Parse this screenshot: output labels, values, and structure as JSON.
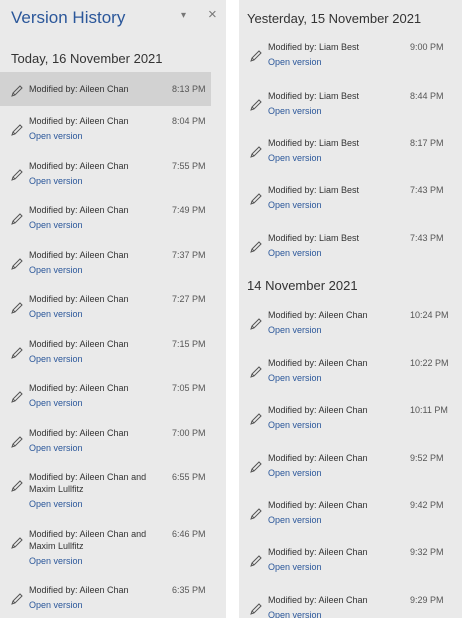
{
  "left_panel": {
    "title": "Version History",
    "chevron_glyph": "▾",
    "close_glyph": "×",
    "section": "Today, 16 November 2021",
    "entries": [
      {
        "by": "Modified by: Aileen Chan",
        "time": "8:13 PM"
      },
      {
        "by": "Modified by: Aileen Chan",
        "time": "8:04 PM",
        "link": "Open version"
      },
      {
        "by": "Modified by: Aileen Chan",
        "time": "7:55 PM",
        "link": "Open version"
      },
      {
        "by": "Modified by: Aileen Chan",
        "time": "7:49 PM",
        "link": "Open version"
      },
      {
        "by": "Modified by: Aileen Chan",
        "time": "7:37 PM",
        "link": "Open version"
      },
      {
        "by": "Modified by: Aileen Chan",
        "time": "7:27 PM",
        "link": "Open version"
      },
      {
        "by": "Modified by: Aileen Chan",
        "time": "7:15 PM",
        "link": "Open version"
      },
      {
        "by": "Modified by: Aileen Chan",
        "time": "7:05 PM",
        "link": "Open version"
      },
      {
        "by": "Modified by: Aileen Chan",
        "time": "7:00 PM",
        "link": "Open version"
      },
      {
        "by": "Modified by: Aileen Chan and",
        "by2": "Maxim Lullfitz",
        "time": "6:55 PM",
        "link": "Open version"
      },
      {
        "by": "Modified by: Aileen Chan and",
        "by2": "Maxim Lullfitz",
        "time": "6:46 PM",
        "link": "Open version"
      },
      {
        "by": "Modified by: Aileen Chan",
        "time": "6:35 PM",
        "link": "Open version"
      }
    ]
  },
  "right_panel": {
    "section_yesterday": "Yesterday, 15 November 2021",
    "yesterday_entries": [
      {
        "by": "Modified by: Liam Best",
        "time": "9:00 PM",
        "link": "Open version"
      },
      {
        "by": "Modified by: Liam Best",
        "time": "8:44 PM",
        "link": "Open version"
      },
      {
        "by": "Modified by: Liam Best",
        "time": "8:17 PM",
        "link": "Open version"
      },
      {
        "by": "Modified by: Liam Best",
        "time": "7:43 PM",
        "link": "Open version"
      },
      {
        "by": "Modified by: Liam Best",
        "time": "7:43 PM",
        "link": "Open version"
      }
    ],
    "section_14nov": "14 November 2021",
    "nov14_entries": [
      {
        "by": "Modified by: Aileen Chan",
        "time": "10:24 PM",
        "link": "Open version"
      },
      {
        "by": "Modified by: Aileen Chan",
        "time": "10:22 PM",
        "link": "Open version"
      },
      {
        "by": "Modified by: Aileen Chan",
        "time": "10:11 PM",
        "link": "Open version"
      },
      {
        "by": "Modified by: Aileen Chan",
        "time": "9:52 PM",
        "link": "Open version"
      },
      {
        "by": "Modified by: Aileen Chan",
        "time": "9:42 PM",
        "link": "Open version"
      },
      {
        "by": "Modified by: Aileen Chan",
        "time": "9:32 PM",
        "link": "Open version"
      },
      {
        "by": "Modified by: Aileen Chan",
        "time": "9:29 PM",
        "link": "Open version"
      }
    ]
  }
}
